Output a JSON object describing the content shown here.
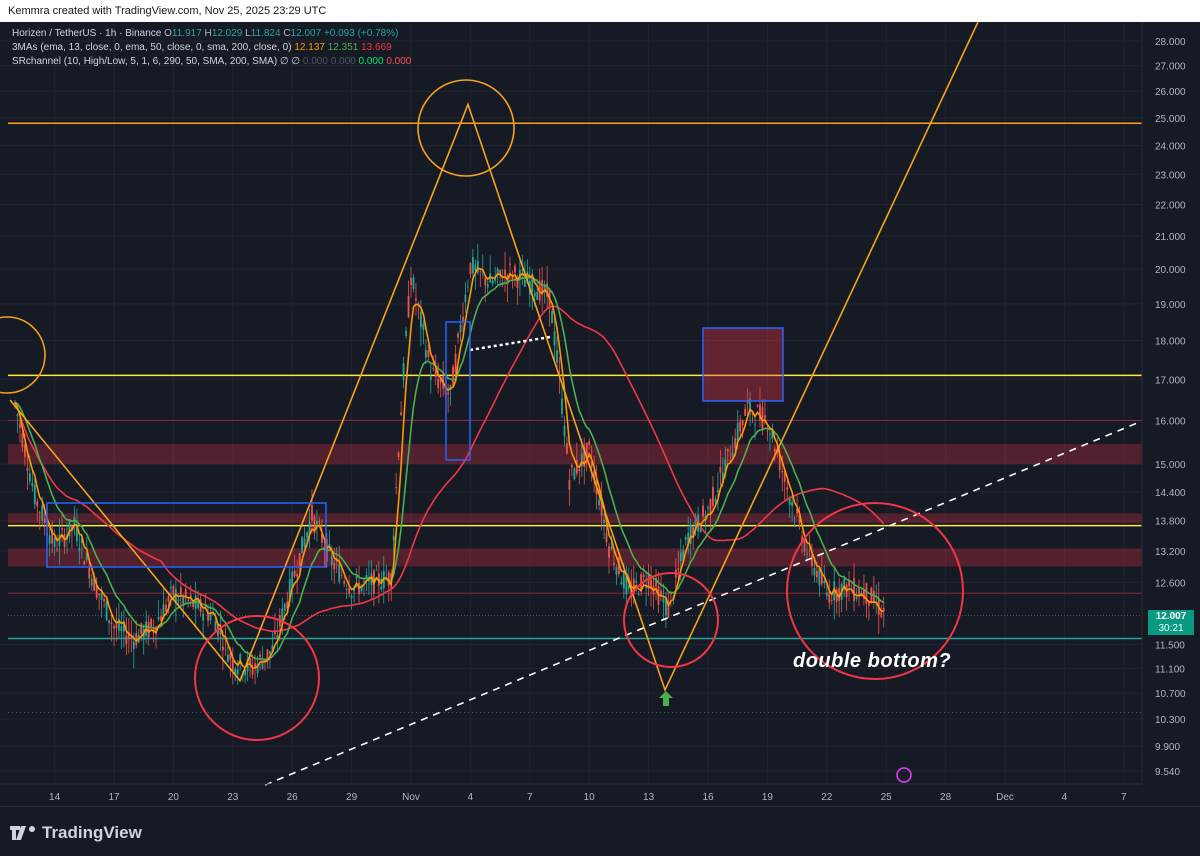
{
  "header": {
    "attribution": "Kemmra created with TradingView.com, Nov 25, 2025 23:29 UTC"
  },
  "legend": {
    "symbol": "Horizen / TetherUS · 1h · Binance",
    "o": "11.917",
    "h": "12.029",
    "l": "11.824",
    "c": "12.007",
    "change": " +0.093 (+0.78%)",
    "ma_title": "3MAs (ema, 13, close, 0, ema, 50, close, 0, sma, 200, close, 0)",
    "ma1": " 12.137",
    "ma2": " 12.351",
    "ma3": " 13.669",
    "sr_title": "SRchannel (10, High/Low, 5, 1, 6, 290, 50, SMA, 200, SMA)  ∅  ∅",
    "sr_v1": " 0.000",
    "sr_v2": " 0.000",
    "sr_v3": " 0.000",
    "sr_v4": " 0.000"
  },
  "last_price": {
    "value": "12.007",
    "countdown": "30:21"
  },
  "annotation": {
    "text": "double bottom?"
  },
  "footer": {
    "brand": "TradingView"
  },
  "colors": {
    "background": "#161a25",
    "up": "#26a69a",
    "down": "#ef5350",
    "ema13": "#ff9800",
    "ema50": "#4caf50",
    "sma200": "#f23645",
    "drawing_orange": "#f7a21b",
    "level_yellow": "#ffeb3b",
    "box_blue": "#2962ff",
    "circle_red": "#f23645"
  },
  "chart_data": {
    "type": "candlestick",
    "title": "Horizen / TetherUS · 1h · Binance",
    "price_ticks": [
      "28.000",
      "27.000",
      "26.000",
      "25.000",
      "24.000",
      "23.000",
      "22.000",
      "21.000",
      "20.000",
      "19.000",
      "18.000",
      "17.000",
      "16.000",
      "15.000",
      "14.400",
      "13.800",
      "13.200",
      "12.600",
      "11.500",
      "11.100",
      "10.700",
      "10.300",
      "9.900",
      "9.540"
    ],
    "time_ticks": [
      "14",
      "17",
      "20",
      "23",
      "26",
      "29",
      "Nov",
      "4",
      "7",
      "10",
      "13",
      "16",
      "19",
      "22",
      "25",
      "28",
      "Dec",
      "4",
      "7"
    ],
    "ylim": [
      9.54,
      28.0
    ],
    "scale": "log",
    "series_close": [
      {
        "date": "2025-10-12",
        "close": 16.4
      },
      {
        "date": "2025-10-13",
        "close": 14.3
      },
      {
        "date": "2025-10-14",
        "close": 13.3
      },
      {
        "date": "2025-10-15",
        "close": 13.7
      },
      {
        "date": "2025-10-16",
        "close": 12.6
      },
      {
        "date": "2025-10-17",
        "close": 11.8
      },
      {
        "date": "2025-10-18",
        "close": 11.6
      },
      {
        "date": "2025-10-19",
        "close": 11.8
      },
      {
        "date": "2025-10-20",
        "close": 12.4
      },
      {
        "date": "2025-10-21",
        "close": 12.2
      },
      {
        "date": "2025-10-22",
        "close": 12.0
      },
      {
        "date": "2025-10-23",
        "close": 11.2
      },
      {
        "date": "2025-10-24",
        "close": 11.1
      },
      {
        "date": "2025-10-25",
        "close": 11.4
      },
      {
        "date": "2025-10-26",
        "close": 12.6
      },
      {
        "date": "2025-10-27",
        "close": 13.9
      },
      {
        "date": "2025-10-28",
        "close": 13.0
      },
      {
        "date": "2025-10-29",
        "close": 12.5
      },
      {
        "date": "2025-10-30",
        "close": 12.6
      },
      {
        "date": "2025-10-31",
        "close": 12.7
      },
      {
        "date": "2025-11-01",
        "close": 19.8
      },
      {
        "date": "2025-11-02",
        "close": 17.2
      },
      {
        "date": "2025-11-03",
        "close": 16.6
      },
      {
        "date": "2025-11-04",
        "close": 20.1
      },
      {
        "date": "2025-11-05",
        "close": 19.6
      },
      {
        "date": "2025-11-06",
        "close": 19.9
      },
      {
        "date": "2025-11-07",
        "close": 19.6
      },
      {
        "date": "2025-11-08",
        "close": 19.2
      },
      {
        "date": "2025-11-09",
        "close": 14.7
      },
      {
        "date": "2025-11-10",
        "close": 15.3
      },
      {
        "date": "2025-11-11",
        "close": 13.3
      },
      {
        "date": "2025-11-12",
        "close": 12.4
      },
      {
        "date": "2025-11-13",
        "close": 12.7
      },
      {
        "date": "2025-11-14",
        "close": 12.1
      },
      {
        "date": "2025-11-15",
        "close": 13.5
      },
      {
        "date": "2025-11-16",
        "close": 14.0
      },
      {
        "date": "2025-11-17",
        "close": 15.1
      },
      {
        "date": "2025-11-18",
        "close": 16.3
      },
      {
        "date": "2025-11-19",
        "close": 16.0
      },
      {
        "date": "2025-11-20",
        "close": 14.5
      },
      {
        "date": "2025-11-21",
        "close": 13.2
      },
      {
        "date": "2025-11-22",
        "close": 12.4
      },
      {
        "date": "2025-11-23",
        "close": 12.5
      },
      {
        "date": "2025-11-24",
        "close": 12.4
      },
      {
        "date": "2025-11-25",
        "close": 12.0
      }
    ],
    "levels": [
      {
        "name": "resistance-25",
        "price": 24.8,
        "color": "#f7a21b"
      },
      {
        "name": "resistance-17",
        "price": 17.1,
        "color": "#ffeb3b"
      },
      {
        "name": "resistance-13.7",
        "price": 13.7,
        "color": "#ffeb3b"
      },
      {
        "name": "support-11.6",
        "price": 11.6,
        "color": "#26a69a"
      }
    ],
    "bands": [
      [
        15.0,
        15.45
      ],
      [
        13.75,
        13.95
      ],
      [
        12.9,
        13.25
      ]
    ],
    "annotation": "double bottom?"
  }
}
